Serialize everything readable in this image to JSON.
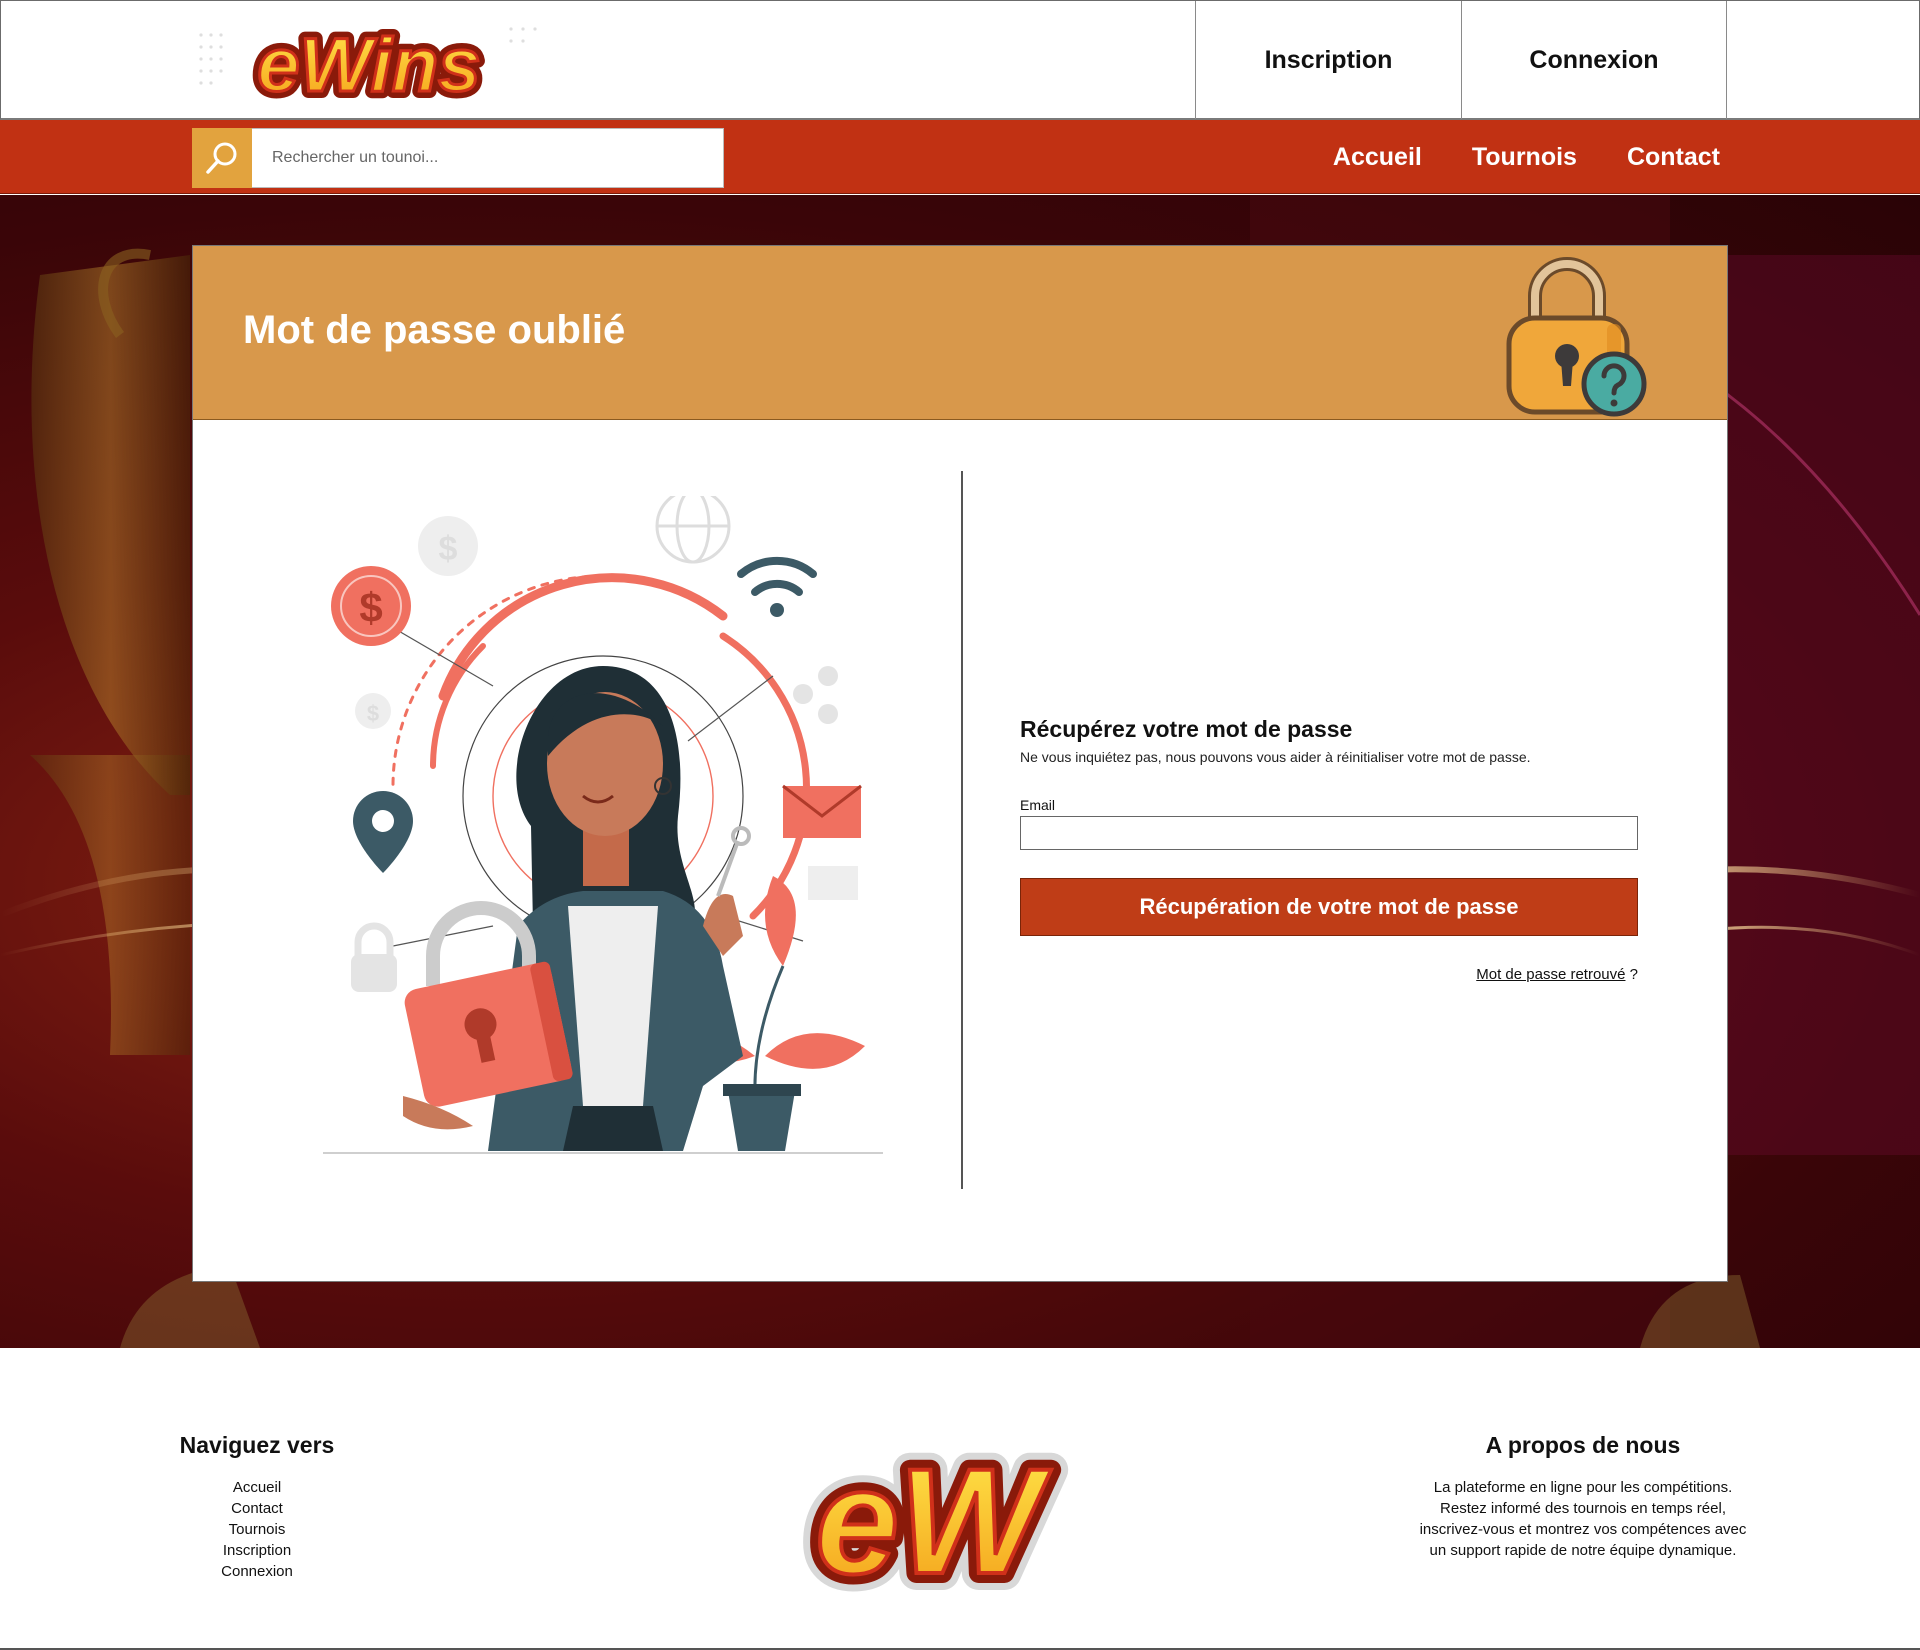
{
  "header": {
    "logo_text": "eWins",
    "links": [
      "Inscription",
      "Connexion"
    ]
  },
  "navbar": {
    "search_placeholder": "Rechercher un tounoi...",
    "links": [
      "Accueil",
      "Tournois",
      "Contact"
    ]
  },
  "card": {
    "title": "Mot de passe oublié",
    "form": {
      "title": "Récupérez votre mot de passe",
      "subtitle": "Ne vous inquiétez pas, nous pouvons vous aider à réinitialiser votre mot de passe.",
      "email_label": "Email",
      "email_value": "",
      "submit_label": "Récupération de votre mot de passe",
      "found_link": "Mot de passe retrouvé",
      "found_suffix": " ?"
    }
  },
  "footer": {
    "nav_title": "Naviguez vers",
    "nav_links": [
      "Accueil",
      "Contact",
      "Tournois",
      "Inscription",
      "Connexion"
    ],
    "logo_text": "eW",
    "about_title": "A propos de nous",
    "about_lines": [
      "La plateforme en ligne pour les compétitions.",
      "Restez informé des tournois en temps réel,",
      "inscrivez-vous et montrez vos compétences avec",
      "un support rapide de notre équipe dynamique."
    ]
  },
  "colors": {
    "navbar": "#c13113",
    "card_header": "#d8984b",
    "button": "#bf3d17",
    "search_button": "#e2a33e"
  }
}
